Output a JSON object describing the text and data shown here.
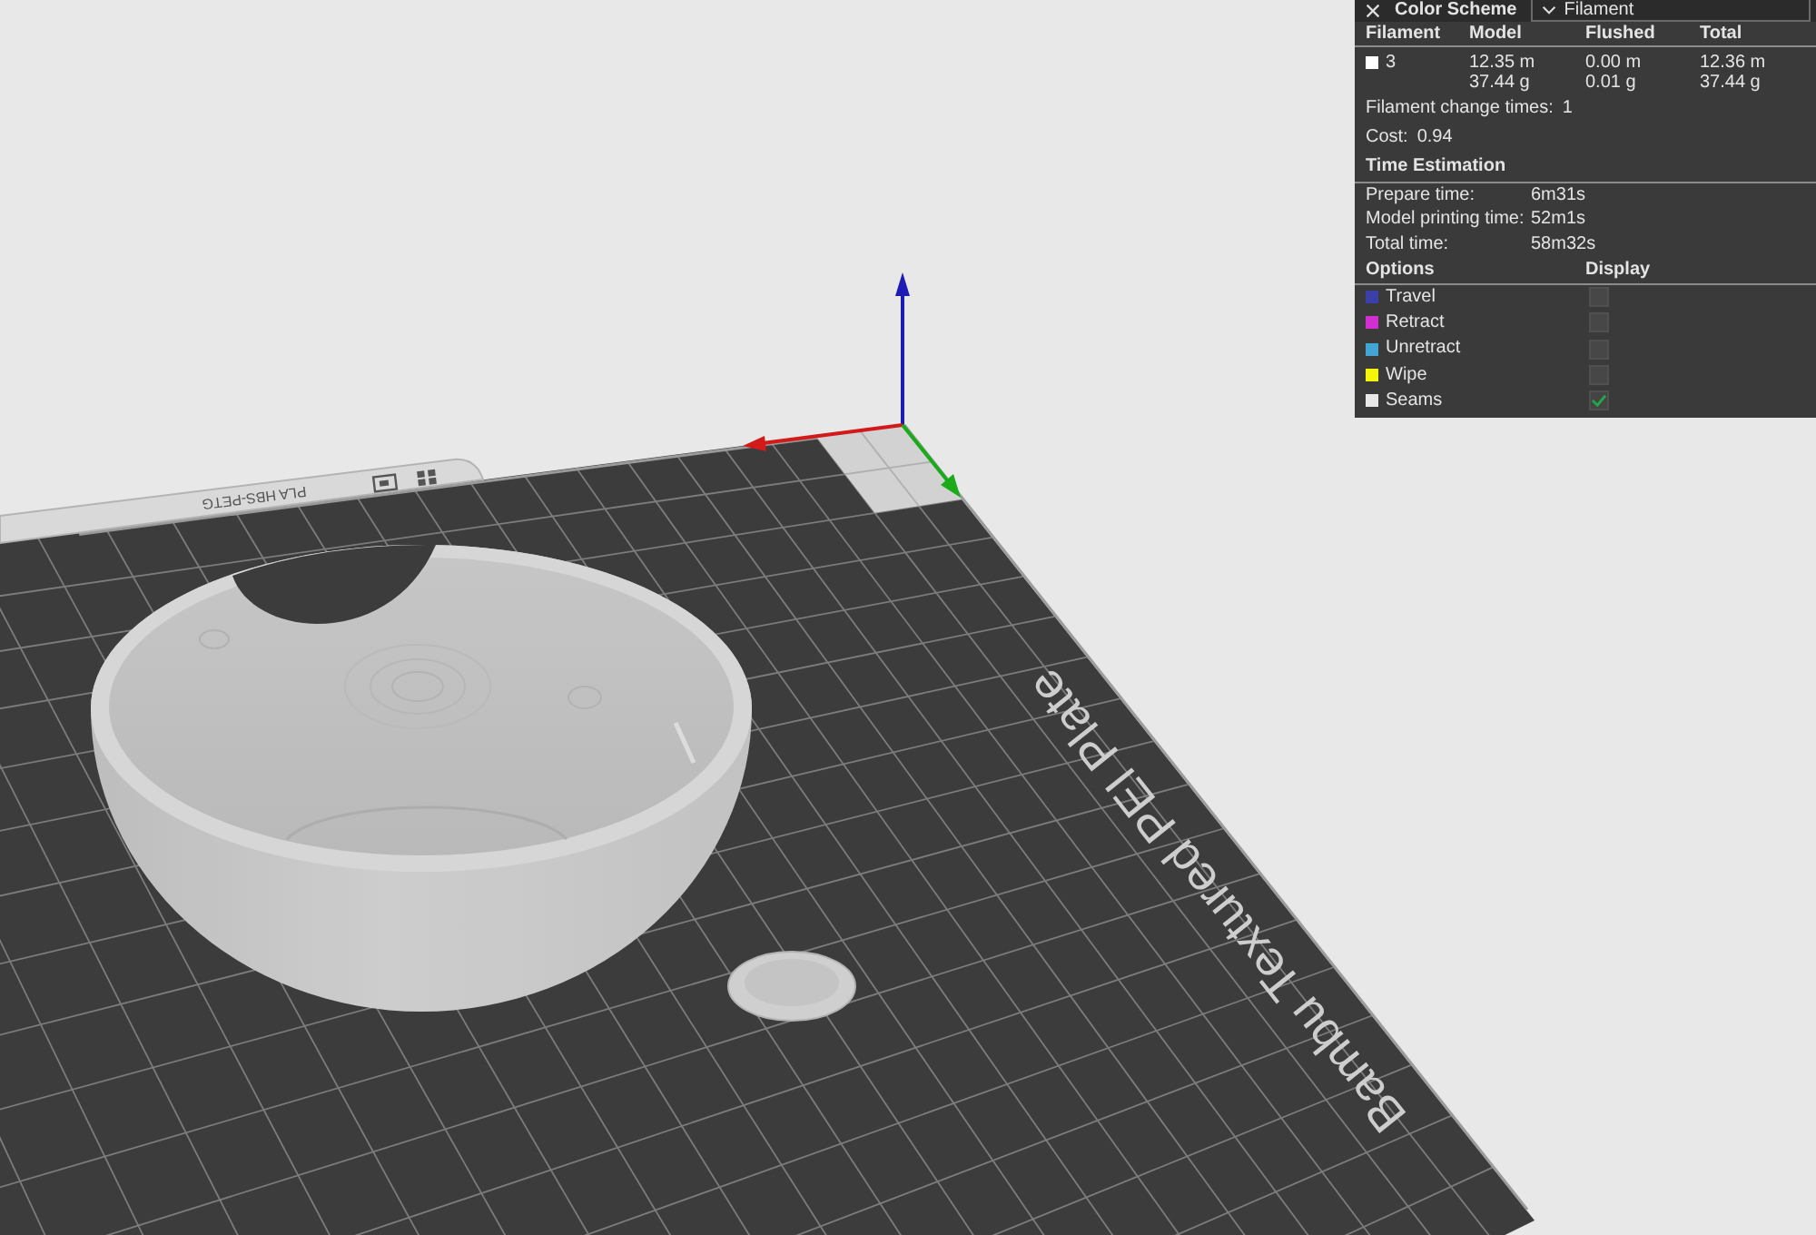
{
  "viewport": {
    "plate_label": "PLA HBS-PETG",
    "plate_name": "Bambu Textured PEI Plate"
  },
  "legend": {
    "color_scheme": {
      "label": "Color Scheme",
      "value": "Filament"
    },
    "filament_table": {
      "columns": [
        "Filament",
        "Model",
        "Flushed",
        "Total"
      ],
      "rows": [
        {
          "filament": "3",
          "color": "#ffffff",
          "model": [
            "12.35 m",
            "37.44 g"
          ],
          "flushed": [
            "0.00 m",
            "0.01 g"
          ],
          "total": [
            "12.36 m",
            "37.44 g"
          ]
        }
      ]
    },
    "filament_change": {
      "label": "Filament change times:",
      "value": "1"
    },
    "cost": {
      "label": "Cost:",
      "value": "0.94"
    },
    "time_estimation": {
      "title": "Time Estimation",
      "rows": [
        {
          "label": "Prepare time:",
          "value": "6m31s"
        },
        {
          "label": "Model printing time:",
          "value": "52m1s"
        },
        {
          "label": "Total time:",
          "value": "58m32s"
        }
      ]
    },
    "options": {
      "columns": [
        "Options",
        "Display"
      ],
      "items": [
        {
          "label": "Travel",
          "color": "#3b3fa8",
          "checked": false
        },
        {
          "label": "Retract",
          "color": "#d22fd2",
          "checked": false
        },
        {
          "label": "Unretract",
          "color": "#43a5d5",
          "checked": false
        },
        {
          "label": "Wipe",
          "color": "#f5f50a",
          "checked": false
        },
        {
          "label": "Seams",
          "color": "#e8e8e8",
          "checked": true
        }
      ]
    }
  }
}
